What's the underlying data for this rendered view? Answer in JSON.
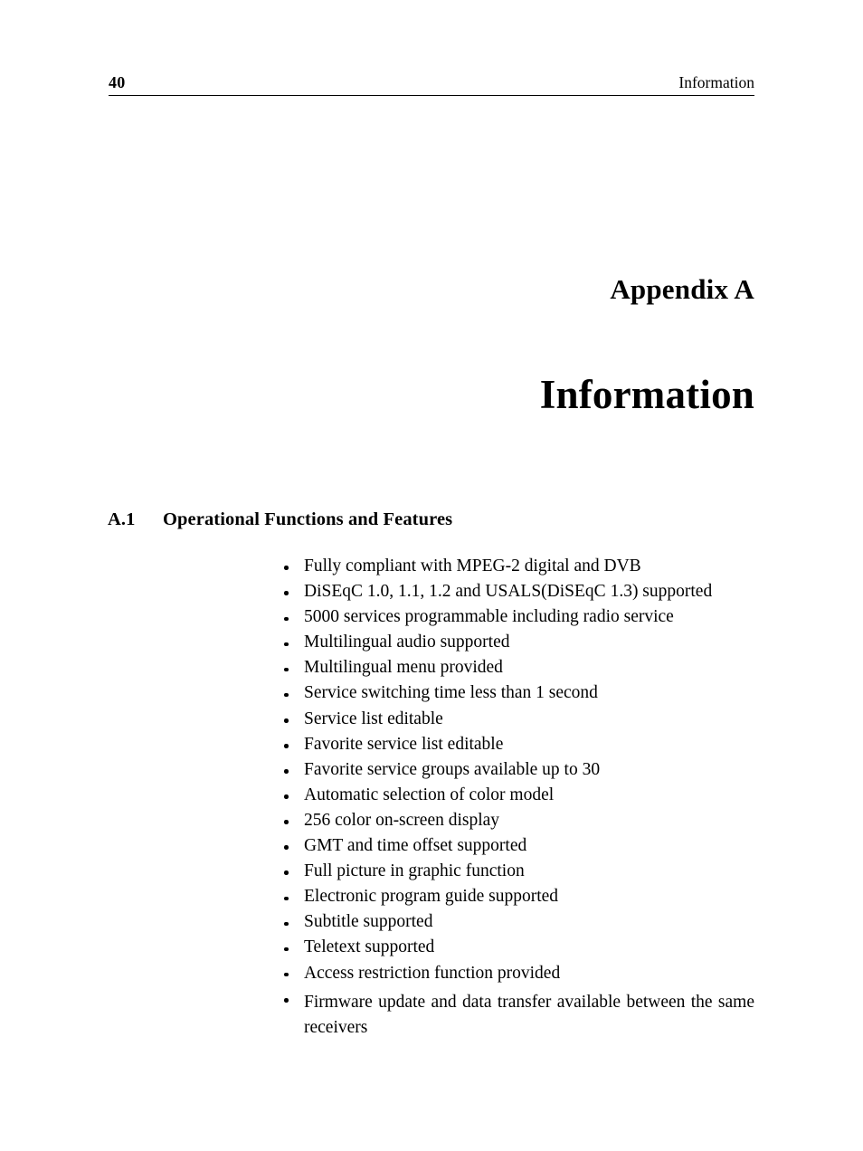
{
  "header": {
    "page_number": "40",
    "running_title": "Information"
  },
  "appendix": {
    "label": "Appendix A",
    "chapter_title": "Information"
  },
  "section": {
    "number": "A.1",
    "title": "Operational Functions and Features"
  },
  "features": [
    "Fully compliant with MPEG-2 digital and DVB",
    "DiSEqC 1.0, 1.1, 1.2 and USALS(DiSEqC 1.3) supported",
    "5000 services programmable including radio service",
    "Multilingual audio supported",
    "Multilingual menu provided",
    "Service switching time less than 1 second",
    "Service list editable",
    "Favorite service list editable",
    "Favorite service groups available up to 30",
    "Automatic selection of color model",
    "256 color on-screen display",
    "GMT and time offset supported",
    "Full picture in graphic function",
    "Electronic program guide supported",
    "Subtitle supported",
    "Teletext supported",
    "Access restriction function provided",
    "Firmware update and data transfer available between the same receivers"
  ],
  "colors": {
    "text": "#000000",
    "background": "#ffffff",
    "rule": "#000000"
  }
}
